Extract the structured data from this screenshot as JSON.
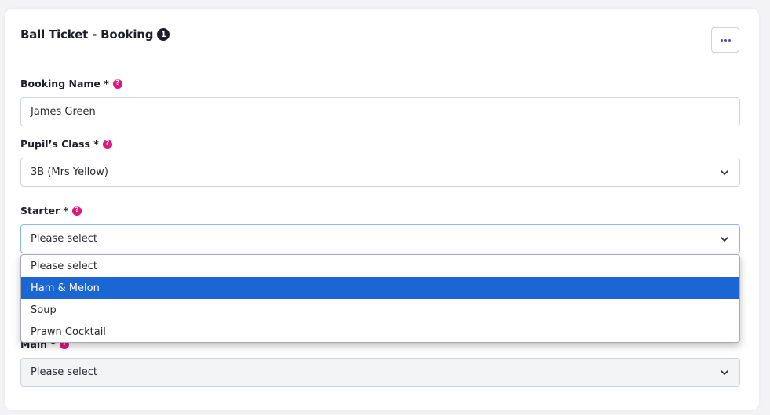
{
  "booking": {
    "title": "Ball Ticket - Booking",
    "badge": "1",
    "menu_icon": "ellipsis-icon"
  },
  "fields": {
    "booking_name": {
      "label": "Booking Name *",
      "value": "James Green"
    },
    "pupils_class": {
      "label": "Pupil’s Class *",
      "value": "3B (Mrs Yellow)"
    },
    "starter": {
      "label": "Starter *",
      "value": "Please select",
      "options": [
        "Please select",
        "Ham & Melon",
        "Soup",
        "Prawn Cocktail"
      ],
      "highlighted": "Ham & Melon"
    },
    "main": {
      "label": "Main *",
      "value": "Please select"
    }
  },
  "help_glyph": "?",
  "colors": {
    "help_icon": "#e0167e",
    "highlight": "#1a66d2",
    "focus_border": "#86b7fe",
    "menu_dots": "#5a48b8"
  }
}
